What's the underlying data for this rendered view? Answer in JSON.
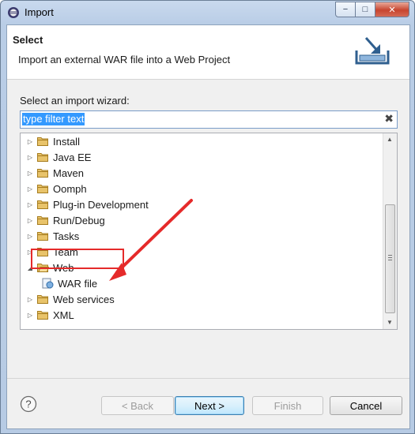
{
  "window": {
    "title": "Import",
    "controls": {
      "minimize": "−",
      "maximize": "□",
      "close": "✕"
    }
  },
  "header": {
    "title": "Select",
    "description": "Import an external WAR file into a Web Project",
    "icon": "import-wizard-icon"
  },
  "wizard": {
    "label": "Select an import wizard:",
    "filter": {
      "value": "type filter text",
      "clear": "✖"
    },
    "items": [
      {
        "label": "Install",
        "expanded": false
      },
      {
        "label": "Java EE",
        "expanded": false
      },
      {
        "label": "Maven",
        "expanded": false
      },
      {
        "label": "Oomph",
        "expanded": false
      },
      {
        "label": "Plug-in Development",
        "expanded": false
      },
      {
        "label": "Run/Debug",
        "expanded": false
      },
      {
        "label": "Tasks",
        "expanded": false
      },
      {
        "label": "Team",
        "expanded": false
      },
      {
        "label": "Web",
        "expanded": true
      },
      {
        "label": "WAR file",
        "child": true,
        "selected": true
      },
      {
        "label": "Web services",
        "expanded": false
      },
      {
        "label": "XML",
        "expanded": false
      }
    ]
  },
  "annotation": {
    "color": "#e52a2a"
  },
  "buttons": {
    "back": "< Back",
    "next": "Next >",
    "finish": "Finish",
    "cancel": "Cancel"
  },
  "colors": {
    "selection": "#3399ff",
    "folder": "#e8c36a"
  }
}
